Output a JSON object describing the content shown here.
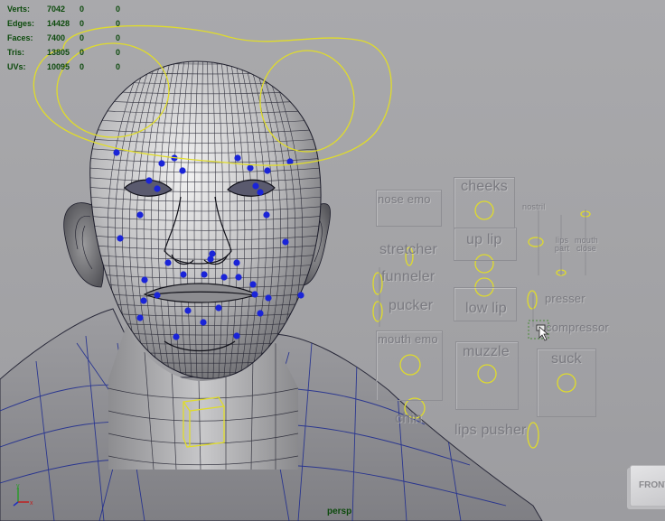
{
  "hud": {
    "rows": [
      {
        "label": "Verts:",
        "v1": "7042",
        "v2": "0",
        "v3": "0"
      },
      {
        "label": "Edges:",
        "v1": "14428",
        "v2": "0",
        "v3": "0"
      },
      {
        "label": "Faces:",
        "v1": "7400",
        "v2": "0",
        "v3": "0"
      },
      {
        "label": "Tris:",
        "v1": "13805",
        "v2": "0",
        "v3": "0"
      },
      {
        "label": "UVs:",
        "v1": "10095",
        "v2": "0",
        "v3": "0"
      }
    ]
  },
  "controls": {
    "nose_emo": "nose emo",
    "cheeks": "cheeks",
    "nostril": "nostril",
    "stretcher": "stretcher",
    "up_lip": "up lip",
    "lips_part": "lips part",
    "mouth_close": "mouth close",
    "funneler": "funneler",
    "pucker": "pucker",
    "low_lip": "low lip",
    "presser": "presser",
    "compressor": "compressor",
    "mouth_emo": "mouth emo",
    "muzzle": "muzzle",
    "suck": "suck",
    "chin": "chin",
    "lips_pusher": "lips pusher"
  },
  "camera": "persp",
  "view_cube": "FRONT",
  "colors": {
    "hud_text": "#0c4a0c",
    "curve": "#e0dc2a",
    "joint": "#1a24d8",
    "wire": "#1c1c2a",
    "jacket_wire": "#1a2890"
  },
  "icons": [
    "axis-gizmo-icon",
    "view-cube-icon",
    "mouse-cursor-icon"
  ]
}
